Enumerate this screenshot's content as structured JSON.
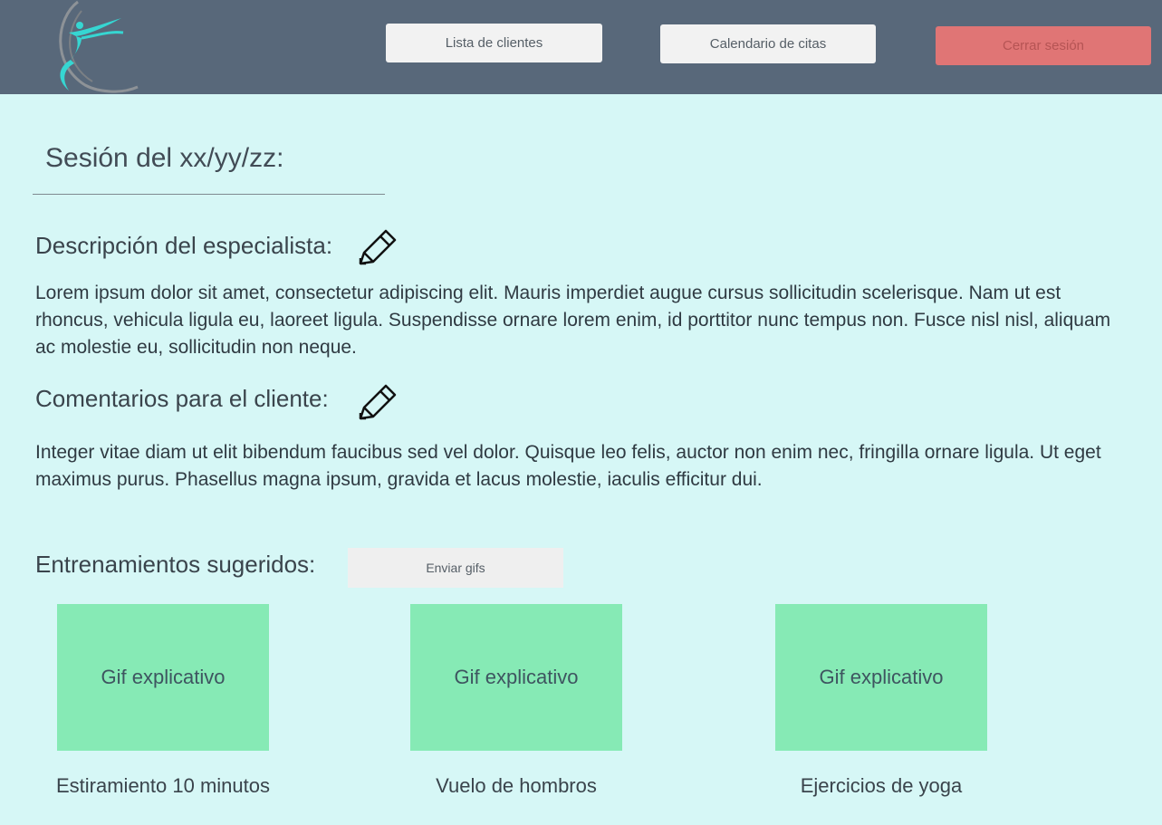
{
  "nav": {
    "clients_label": "Lista de clientes",
    "calendar_label": "Calendario de citas",
    "logout_label": "Cerrar sesión"
  },
  "session": {
    "title": "Sesión del xx/yy/zz:"
  },
  "specialist": {
    "label": "Descripción del especialista:",
    "text": "Lorem ipsum dolor sit amet, consectetur adipiscing elit. Mauris imperdiet augue cursus sollicitudin scelerisque. Nam ut est rhoncus, vehicula ligula eu, laoreet ligula. Suspendisse ornare lorem enim, id porttitor nunc tempus non. Fusce nisl nisl, aliquam ac molestie eu, sollicitudin non neque."
  },
  "comments": {
    "label": "Comentarios para el cliente:",
    "text": "Integer vitae diam ut elit bibendum faucibus sed vel dolor. Quisque leo felis, auctor non enim nec, fringilla ornare ligula. Ut eget maximus purus. Phasellus magna ipsum, gravida et lacus molestie, iaculis efficitur dui."
  },
  "trainings": {
    "label": "Entrenamientos sugeridos:",
    "send_label": "Enviar gifs",
    "items": [
      {
        "gif_label": "Gif explicativo",
        "caption": "Estiramiento 10 minutos"
      },
      {
        "gif_label": "Gif explicativo",
        "caption": "Vuelo de hombros"
      },
      {
        "gif_label": "Gif explicativo",
        "caption": "Ejercicios de yoga"
      }
    ]
  },
  "colors": {
    "header_bg": "#58687a",
    "page_bg": "#d6f7f6",
    "logout_bg": "#e07575",
    "gif_bg": "#86eab5"
  },
  "icons": {
    "logo": "dancer-logo-icon",
    "edit": "pencil-icon"
  }
}
